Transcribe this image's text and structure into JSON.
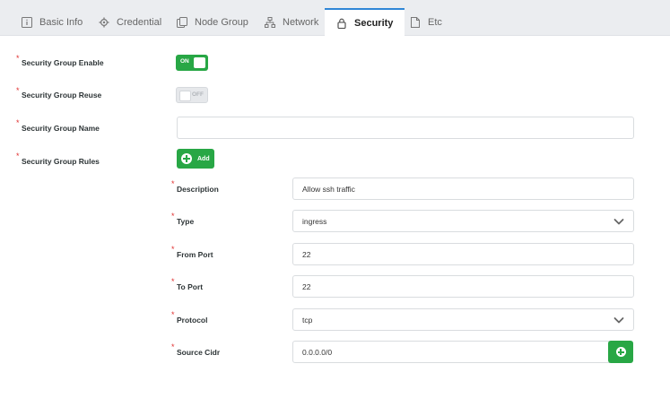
{
  "tabs": [
    {
      "label": "Basic Info",
      "icon": "info-icon"
    },
    {
      "label": "Credential",
      "icon": "gear-icon"
    },
    {
      "label": "Node Group",
      "icon": "node-group-icon"
    },
    {
      "label": "Network",
      "icon": "network-icon"
    },
    {
      "label": "Security",
      "icon": "lock-icon",
      "active": true
    },
    {
      "label": "Etc",
      "icon": "file-icon"
    }
  ],
  "form": {
    "required_mark": "*",
    "sg_enable": {
      "label": "Security Group Enable",
      "toggle_text": "ON",
      "state": true
    },
    "sg_reuse": {
      "label": "Security Group Reuse",
      "toggle_text": "OFF",
      "state": false
    },
    "sg_name": {
      "label": "Security Group Name",
      "value": ""
    },
    "sg_rules": {
      "label": "Security Group Rules",
      "add_label": "Add"
    }
  },
  "rule": {
    "description": {
      "label": "Description",
      "value": "Allow ssh traffic"
    },
    "type": {
      "label": "Type",
      "value": "ingress"
    },
    "from_port": {
      "label": "From Port",
      "value": "22"
    },
    "to_port": {
      "label": "To Port",
      "value": "22"
    },
    "protocol": {
      "label": "Protocol",
      "value": "tcp"
    },
    "source_cidr": {
      "label": "Source Cidr",
      "value": "0.0.0.0/0"
    }
  },
  "colors": {
    "accent_green": "#28a745",
    "active_tab_border": "#2f86d6",
    "required_red": "#e03131"
  }
}
